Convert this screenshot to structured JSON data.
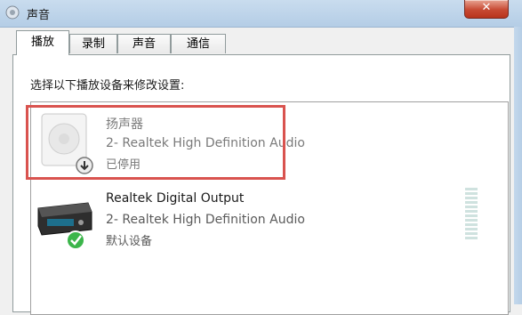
{
  "window": {
    "title": "声音",
    "close_label": "✕"
  },
  "tabs": [
    {
      "label": "播放",
      "active": true
    },
    {
      "label": "录制"
    },
    {
      "label": "声音"
    },
    {
      "label": "通信"
    }
  ],
  "instruction": "选择以下播放设备来修改设置:",
  "devices": [
    {
      "name": "扬声器",
      "description": "2- Realtek High Definition Audio",
      "status": "已停用",
      "icon": "speaker-icon"
    },
    {
      "name": "Realtek Digital Output",
      "description": "2- Realtek High Definition Audio",
      "status": "默认设备",
      "icon": "digital-output-icon"
    }
  ],
  "colors": {
    "highlight": "#d9534f",
    "titlebar": "#c9dcee",
    "check": "#3bb54a"
  }
}
